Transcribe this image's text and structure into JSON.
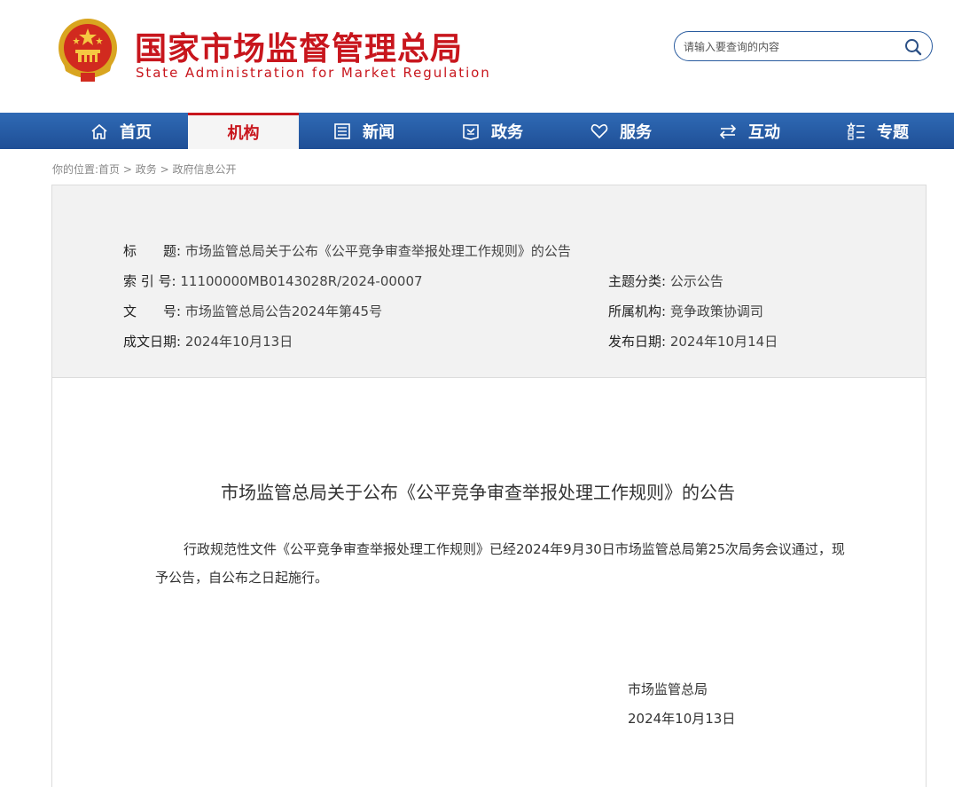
{
  "header": {
    "title_cn": "国家市场监督管理总局",
    "title_en": "State Administration for Market Regulation"
  },
  "search": {
    "placeholder": "请输入要查询的内容"
  },
  "nav": {
    "items": [
      {
        "label": "首页",
        "icon": "home-icon"
      },
      {
        "label": "机构",
        "icon": ""
      },
      {
        "label": "新闻",
        "icon": "news-icon"
      },
      {
        "label": "政务",
        "icon": "government-icon"
      },
      {
        "label": "服务",
        "icon": "heart-icon"
      },
      {
        "label": "互动",
        "icon": "exchange-icon"
      },
      {
        "label": "专题",
        "icon": "topic-icon"
      }
    ],
    "active_index": 1,
    "accent": "#c8161d",
    "bar_color": "#2a5fa8"
  },
  "breadcrumb": {
    "prefix": "你的位置:",
    "items": [
      "首页",
      "政务",
      "政府信息公开"
    ],
    "separator": ">"
  },
  "meta": {
    "title_label": "标　　题:",
    "title_value": "市场监管总局关于公布《公平竞争审查举报处理工作规则》的公告",
    "index_label": "索 引 号:",
    "index_value": "11100000MB0143028R/2024-00007",
    "topic_label": "主题分类:",
    "topic_value": "公示公告",
    "docno_label": "文　　号:",
    "docno_value": "市场监管总局公告2024年第45号",
    "org_label": "所属机构:",
    "org_value": "竞争政策协调司",
    "created_label": "成文日期:",
    "created_value": "2024年10月13日",
    "published_label": "发布日期:",
    "published_value": "2024年10月14日"
  },
  "article": {
    "title": "市场监管总局关于公布《公平竞争审查举报处理工作规则》的公告",
    "body": "行政规范性文件《公平竞争审查举报处理工作规则》已经2024年9月30日市场监管总局第25次局务会议通过，现予公告，自公布之日起施行。",
    "signature_org": "市场监管总局",
    "signature_date": "2024年10月13日"
  }
}
